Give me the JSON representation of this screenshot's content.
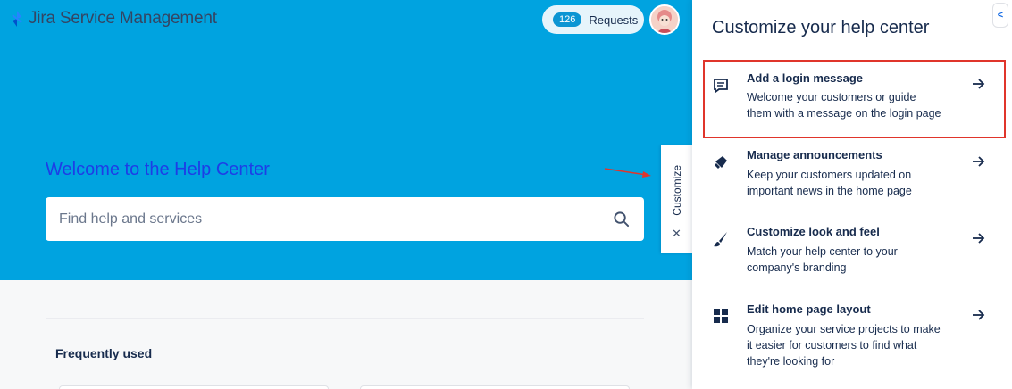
{
  "header": {
    "app_name": "Jira Service Management",
    "requests_count": "126",
    "requests_label": "Requests"
  },
  "hero": {
    "title": "Welcome to the Help Center",
    "search_placeholder": "Find help and services"
  },
  "customize_tab": {
    "label": "Customize",
    "close_glyph": "✕"
  },
  "content": {
    "frequently_used_title": "Frequently used"
  },
  "panel": {
    "title": "Customize your help center",
    "collapse_glyph": "<",
    "items": [
      {
        "icon": "comment-icon",
        "title": "Add a login message",
        "desc_line1": "Welcome your customers or guide",
        "desc_line2": "them with a message on the login page",
        "desc_line3": ""
      },
      {
        "icon": "megaphone-icon",
        "title": "Manage announcements",
        "desc_line1": "Keep your customers updated on",
        "desc_line2": "important news in the home page",
        "desc_line3": ""
      },
      {
        "icon": "paintbrush-icon",
        "title": "Customize look and feel",
        "desc_line1": "Match your help center to your",
        "desc_line2": "company's branding",
        "desc_line3": ""
      },
      {
        "icon": "layout-grid-icon",
        "title": "Edit home page layout",
        "desc_line1": "Organize your service projects to make",
        "desc_line2": "it easier for customers to find what",
        "desc_line3": "they're looking for"
      }
    ]
  },
  "colors": {
    "hero_background": "#00a3e0",
    "hero_title": "#1d3ee6",
    "highlight_border": "#e0352b",
    "badge": "#0c95d3"
  }
}
